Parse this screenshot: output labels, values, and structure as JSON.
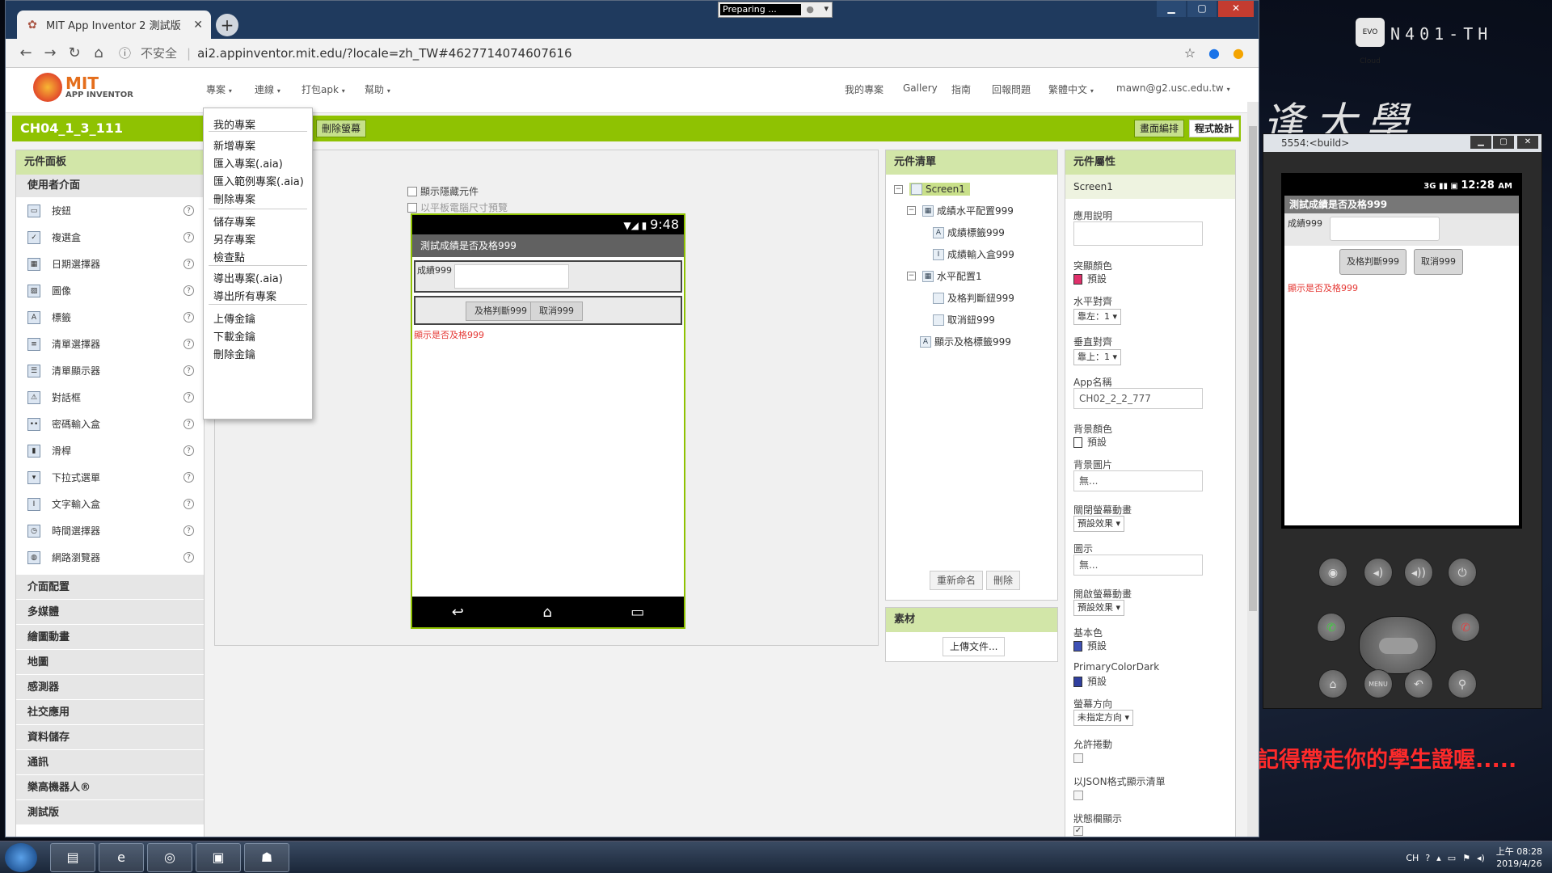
{
  "browser": {
    "tab_title": "MIT App Inventor 2 測試版",
    "url_insecure": "不安全",
    "url": "ai2.appinventor.mit.edu/?locale=zh_TW#4627714074607616"
  },
  "preparing": "Preparing ...",
  "header": {
    "logo_mit": "MIT",
    "logo_sub": "APP INVENTOR",
    "menus": [
      "專案",
      "連線",
      "打包apk",
      "幫助"
    ],
    "right_links": [
      "我的專案",
      "Gallery",
      "指南",
      "回報問題",
      "繁體中文",
      "mawn@g2.usc.edu.tw"
    ]
  },
  "project": {
    "name": "CH04_1_3_111",
    "remove_screen": "刪除螢幕",
    "designer_btn": "畫面編排",
    "blocks_btn": "程式設計"
  },
  "dropdown": {
    "items": [
      "我的專案",
      "新增專案",
      "匯入專案(.aia)",
      "匯入範例專案(.aia)",
      "刪除專案",
      "儲存專案",
      "另存專案",
      "檢查點",
      "導出專案(.aia)",
      "導出所有專案",
      "上傳金鑰",
      "下載金鑰",
      "刪除金鑰"
    ]
  },
  "palette": {
    "title": "元件面板",
    "section": "使用者介面",
    "items": [
      "按鈕",
      "複選盒",
      "日期選擇器",
      "圖像",
      "標籤",
      "清單選擇器",
      "清單顯示器",
      "對話框",
      "密碼輸入盒",
      "滑桿",
      "下拉式選單",
      "文字輸入盒",
      "時間選擇器",
      "網路瀏覽器"
    ],
    "categories": [
      "介面配置",
      "多媒體",
      "繪圖動畫",
      "地圖",
      "感測器",
      "社交應用",
      "資料儲存",
      "通訊",
      "樂高機器人®",
      "測試版"
    ]
  },
  "viewer": {
    "show_hidden": "顯示隱藏元件",
    "tablet_preview": "以平板電腦尺寸預覽",
    "phone_time": "9:48",
    "screen_title": "測試成績是否及格999",
    "score_label": "成績999",
    "pass_button": "及格判斷999",
    "cancel_button": "取消999",
    "result_label": "顯示是否及格999"
  },
  "components": {
    "title": "元件清單",
    "screen": "Screen1",
    "hz1": "成績水平配置999",
    "lbl1": "成績標籤999",
    "txt1": "成績輸入盒999",
    "hz2": "水平配置1",
    "btn1": "及格判斷鈕999",
    "btn2": "取消鈕999",
    "lbl2": "顯示及格標籤999",
    "rename": "重新命名",
    "delete": "刪除"
  },
  "media": {
    "title": "素材",
    "upload": "上傳文件..."
  },
  "properties": {
    "title": "元件屬性",
    "component": "Screen1",
    "about": "應用說明",
    "accent_color": "突顯顏色",
    "default": "預設",
    "align_h": "水平對齊",
    "align_h_val": "靠左：1",
    "align_v": "垂直對齊",
    "align_v_val": "靠上：1",
    "app_name": "App名稱",
    "app_name_val": "CH02_2_2_777",
    "bg_color": "背景顏色",
    "bg_image": "背景圖片",
    "none": "無...",
    "close_anim": "關閉螢幕動畫",
    "default_effect": "預設效果",
    "icon": "圖示",
    "open_anim": "開啟螢幕動畫",
    "primary_color": "基本色",
    "primary_dark": "PrimaryColorDark",
    "orientation": "螢幕方向",
    "orientation_val": "未指定方向",
    "scrollable": "允許捲動",
    "show_json": "以JSON格式顯示清單",
    "status_bar": "狀態欄顯示"
  },
  "emulator": {
    "title": "5554:<build>",
    "time": "12:28",
    "ampm": "AM",
    "app_title": "測試成績是否及格999",
    "score_label": "成績999",
    "pass_button": "及格判斷999",
    "cancel_button": "取消999",
    "result_label": "顯示是否及格999",
    "menu_label": "MENU"
  },
  "desktop": {
    "host": "N401-TH",
    "brush": "逢大學",
    "reminder": "記得帶走你的學生證喔.....",
    "evo": "EVO Cloud"
  },
  "taskbar": {
    "lang": "CH",
    "time": "上午 08:28",
    "date": "2019/4/26"
  },
  "colors": {
    "ai_green": "#8fc202",
    "accent_pink": "#e0306b",
    "primary_blue": "#3f51b5",
    "primary_dark_blue": "#303f9f",
    "error_red": "#e53935"
  }
}
